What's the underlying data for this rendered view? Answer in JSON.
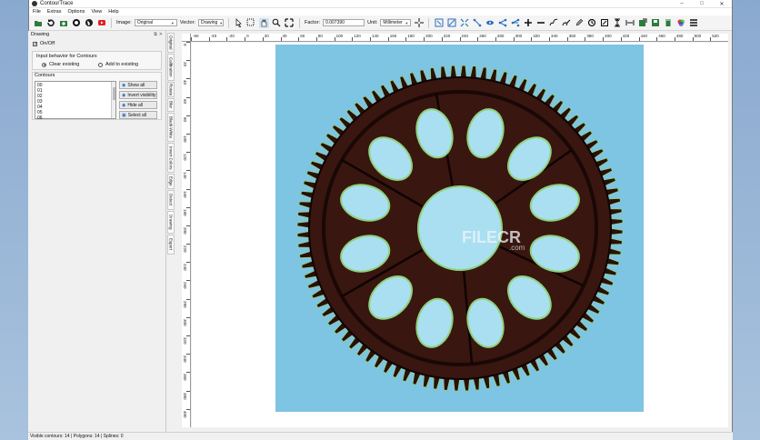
{
  "window": {
    "title": "ContourTrace"
  },
  "menu": [
    "File",
    "Extras",
    "Options",
    "View",
    "Help"
  ],
  "toolbar": {
    "image_label": "Image:",
    "image_value": "Original",
    "vector_label": "Vector:",
    "vector_value": "Drawing",
    "factor_label": "Factor:",
    "factor_value": "0.007390",
    "unit_label": "Unit:",
    "unit_value": "Millimeter"
  },
  "panel": {
    "title": "Drawing",
    "onoff_label": "On/Off",
    "input_behavior_title": "Input behavior for Contours",
    "radio_clear": "Clear existing",
    "radio_add": "Add to existing",
    "contours_title": "Contours",
    "contours": [
      "00",
      "01",
      "02",
      "03",
      "04",
      "05",
      "06"
    ],
    "show_all": "Show all",
    "invert_visibility": "Invert visibility",
    "hide_all": "Hide all",
    "select_all": "Select all"
  },
  "vtabs": [
    "Original",
    "Calibration",
    "Rotate",
    "Blur",
    "Black-White",
    "Invert Colors",
    "Edge",
    "Detect",
    "Drawing",
    "Export"
  ],
  "ruler_top": [
    "-60",
    "-40",
    "-20",
    "0",
    "20",
    "40",
    "60",
    "80",
    "100",
    "120",
    "140",
    "160",
    "180",
    "200",
    "220",
    "240",
    "260",
    "280",
    "300",
    "320",
    "340",
    "360",
    "380",
    "400",
    "420",
    "440",
    "460",
    "480",
    "500",
    "520"
  ],
  "ruler_left": [
    "0",
    "20",
    "40",
    "60",
    "80",
    "100",
    "120",
    "140",
    "160",
    "180",
    "200",
    "220",
    "240",
    "260",
    "280",
    "300",
    "320",
    "340",
    "360",
    "380",
    "400"
  ],
  "status": "Visible contours: 14  |  Polygons: 14  |  Splines: 0",
  "watermark": "FILECR",
  "watermark_sub": ".com",
  "colors": {
    "sky": "#7ec4e3",
    "gear": "#3a1610",
    "contour": "#8fd27a"
  }
}
